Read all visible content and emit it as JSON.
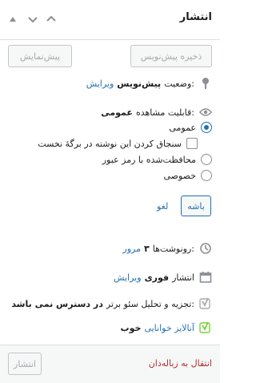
{
  "header": {
    "title": "انتشار",
    "controls": [
      "chevron-up-icon",
      "chevron-down-icon",
      "triangle-up-icon"
    ]
  },
  "actions": {
    "save_draft": "ذخیره پیش‌نویس",
    "preview": "پیش‌نمایش"
  },
  "status": {
    "label": "وضعیت:",
    "value": "پیش‌نویس",
    "edit": "ویرایش",
    "icon": "pin-icon"
  },
  "visibility": {
    "label": "قابلیت مشاهده:",
    "value": "عمومی",
    "icon": "eye-icon",
    "options": {
      "public": "عمومی",
      "sticky": "سنجاق کردن این نوشته در برگهٔ نخست",
      "password": "محافظت‌شده با رمز عبور",
      "private": "خصوصی"
    },
    "selected": "public",
    "ok": "باشه",
    "cancel": "لغو"
  },
  "revisions": {
    "label": "رونوشت‌ها:",
    "count": "۳",
    "browse": "مرور",
    "icon": "history-icon"
  },
  "publish_time": {
    "label": "انتشار",
    "value": "فوری",
    "edit": "ویرایش",
    "icon": "calendar-icon"
  },
  "seo": {
    "text": "تجزیه و تحلیل سئو برتر:",
    "value": "در دسترس نمی باشد",
    "icon": "yoast-icon",
    "color": "#a7aaad"
  },
  "readability": {
    "label": "آنالایز خوانایی",
    "value": "خوب",
    "icon": "yoast-icon",
    "color": "#7ad03a"
  },
  "footer": {
    "trash": "انتقال به زباله‌دان",
    "publish": "انتشار"
  },
  "colors": {
    "link": "#2271b1",
    "danger": "#b32d2e"
  }
}
